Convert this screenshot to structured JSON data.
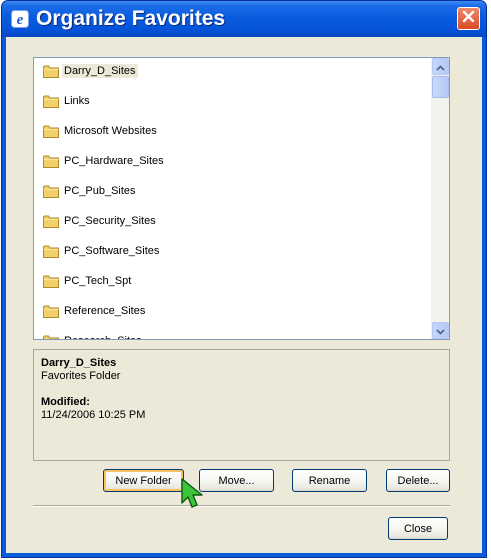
{
  "window": {
    "title": "Organize Favorites"
  },
  "folders": [
    {
      "label": "Darry_D_Sites",
      "selected": true
    },
    {
      "label": "Links"
    },
    {
      "label": "Microsoft Websites"
    },
    {
      "label": "PC_Hardware_Sites"
    },
    {
      "label": "PC_Pub_Sites"
    },
    {
      "label": "PC_Security_Sites"
    },
    {
      "label": "PC_Software_Sites"
    },
    {
      "label": "PC_Tech_Spt"
    },
    {
      "label": "Reference_Sites"
    },
    {
      "label": "Research_Sites"
    }
  ],
  "details": {
    "name": "Darry_D_Sites",
    "type": "Favorites Folder",
    "modified_label": "Modified:",
    "modified_value": "11/24/2006 10:25 PM"
  },
  "buttons": {
    "new_folder": "New Folder",
    "move": "Move...",
    "rename": "Rename",
    "delete": "Delete...",
    "close": "Close"
  },
  "icons": {
    "app": "ie-icon",
    "close": "close-icon",
    "folder": "folder-icon",
    "scroll_up": "scroll-up-icon",
    "scroll_down": "scroll-down-icon",
    "cursor": "mouse-cursor-icon"
  },
  "colors": {
    "titlebar": "#0a5ee0",
    "close_button": "#d84a24",
    "dialog_face": "#ece9d8",
    "folder": "#f2d06a",
    "button_border": "#003c74"
  }
}
